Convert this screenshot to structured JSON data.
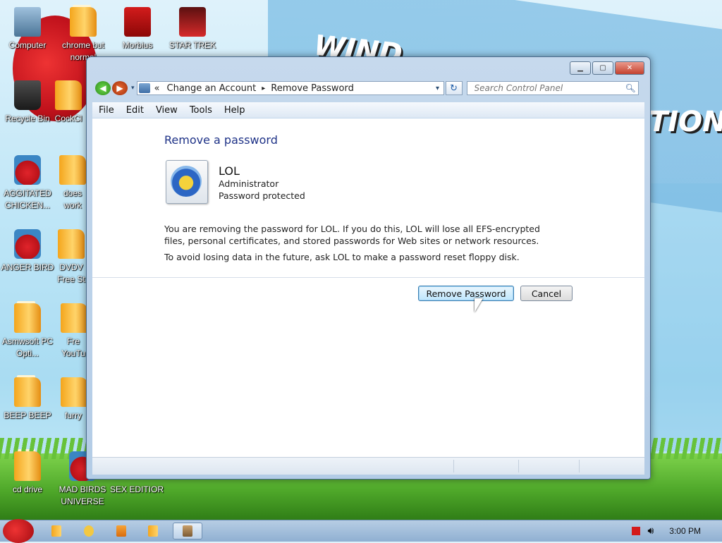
{
  "desktop": {
    "icons": [
      {
        "label": "Computer"
      },
      {
        "label": "chrome but normal"
      },
      {
        "label": "Morbius"
      },
      {
        "label": "STAR TREK"
      },
      {
        "label": "Recycle Bin"
      },
      {
        "label": "CockCl"
      },
      {
        "label": "AGGITATED CHICKEN..."
      },
      {
        "label": "does work"
      },
      {
        "label": "ANGER BIRD"
      },
      {
        "label": "DVDV Free St"
      },
      {
        "label": "Asmwsoft PC Opti..."
      },
      {
        "label": "Fre YouTu"
      },
      {
        "label": "BEEP BEEP"
      },
      {
        "label": "furry"
      },
      {
        "label": "cd drive"
      },
      {
        "label": "MAD BIRDS UNIVERSE"
      },
      {
        "label": "SEX EDITIOR"
      }
    ],
    "wallpaper_text": [
      "WIND",
      "TION"
    ]
  },
  "window": {
    "caption": {
      "minimize": "▁",
      "maximize": "▢",
      "close": "✕"
    },
    "nav": {
      "back": "◀",
      "forward": "▶",
      "history_dropdown": "▾"
    },
    "address": {
      "prefix": "«",
      "crumbs": [
        "Change an Account",
        "Remove Password"
      ],
      "separator": "▸",
      "dropdown": "▾"
    },
    "refresh": "↻",
    "search": {
      "placeholder": "Search Control Panel",
      "icon": "search-icon"
    },
    "menu": [
      "File",
      "Edit",
      "View",
      "Tools",
      "Help"
    ],
    "content": {
      "title": "Remove a password",
      "user": {
        "name": "LOL",
        "role": "Administrator",
        "status": "Password protected"
      },
      "message": "You are removing the password for LOL.  If you do this, LOL will lose all EFS-encrypted files, personal certificates, and stored passwords for Web sites or network resources.",
      "tip": "To avoid losing data in the future, ask LOL to make a password reset floppy disk.",
      "buttons": {
        "remove": "Remove Password",
        "cancel": "Cancel"
      }
    }
  },
  "taskbar": {
    "clock": "3:00 PM",
    "tray_icons": [
      "flag-icon",
      "volume-icon"
    ]
  },
  "colors": {
    "title_blue": "#1e3287",
    "accent": "#3c7fb1"
  }
}
